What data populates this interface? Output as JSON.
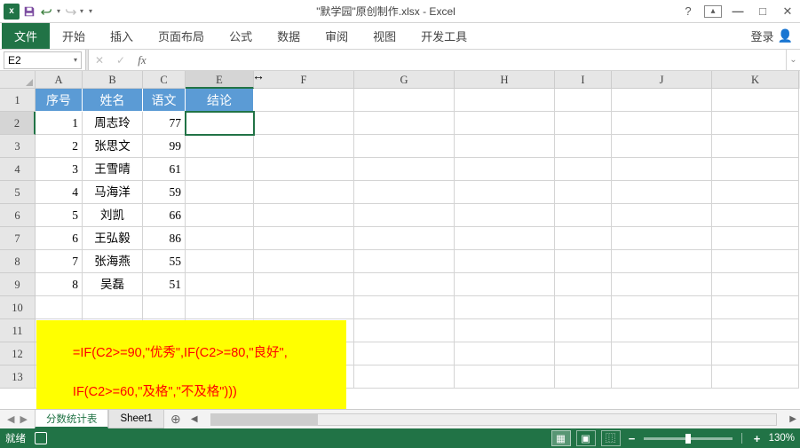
{
  "title": "\"默学园\"原创制作.xlsx - Excel",
  "signin": "登录",
  "ribbon": {
    "file": "文件",
    "home": "开始",
    "insert": "插入",
    "layout": "页面布局",
    "formulas": "公式",
    "data": "数据",
    "review": "审阅",
    "view": "视图",
    "dev": "开发工具"
  },
  "formula_bar": {
    "name_box": "E2",
    "fx": "fx",
    "value": ""
  },
  "columns": [
    "A",
    "B",
    "C",
    "E",
    "F",
    "G",
    "H",
    "I",
    "J",
    "K"
  ],
  "headers": {
    "a": "序号",
    "b": "姓名",
    "c": "语文",
    "e": "结论"
  },
  "rows": [
    {
      "n": "1",
      "name": "周志玲",
      "score": "77"
    },
    {
      "n": "2",
      "name": "张思文",
      "score": "99"
    },
    {
      "n": "3",
      "name": "王雪晴",
      "score": "61"
    },
    {
      "n": "4",
      "name": "马海洋",
      "score": "59"
    },
    {
      "n": "5",
      "name": "刘凯",
      "score": "66"
    },
    {
      "n": "6",
      "name": "王弘毅",
      "score": "86"
    },
    {
      "n": "7",
      "name": "张海燕",
      "score": "55"
    },
    {
      "n": "8",
      "name": "吴磊",
      "score": "51"
    }
  ],
  "row_labels": [
    "1",
    "2",
    "3",
    "4",
    "5",
    "6",
    "7",
    "8",
    "9",
    "10",
    "11",
    "12",
    "13"
  ],
  "formula_note_l1": "=IF(C2>=90,\"优秀\",IF(C2>=80,\"良好\",",
  "formula_note_l2": "IF(C2>=60,\"及格\",\"不及格\")))",
  "resize_glyph": "↔",
  "sheets": {
    "active": "分数统计表",
    "other": "Sheet1"
  },
  "status": {
    "ready": "就绪",
    "zoom": "130%"
  }
}
